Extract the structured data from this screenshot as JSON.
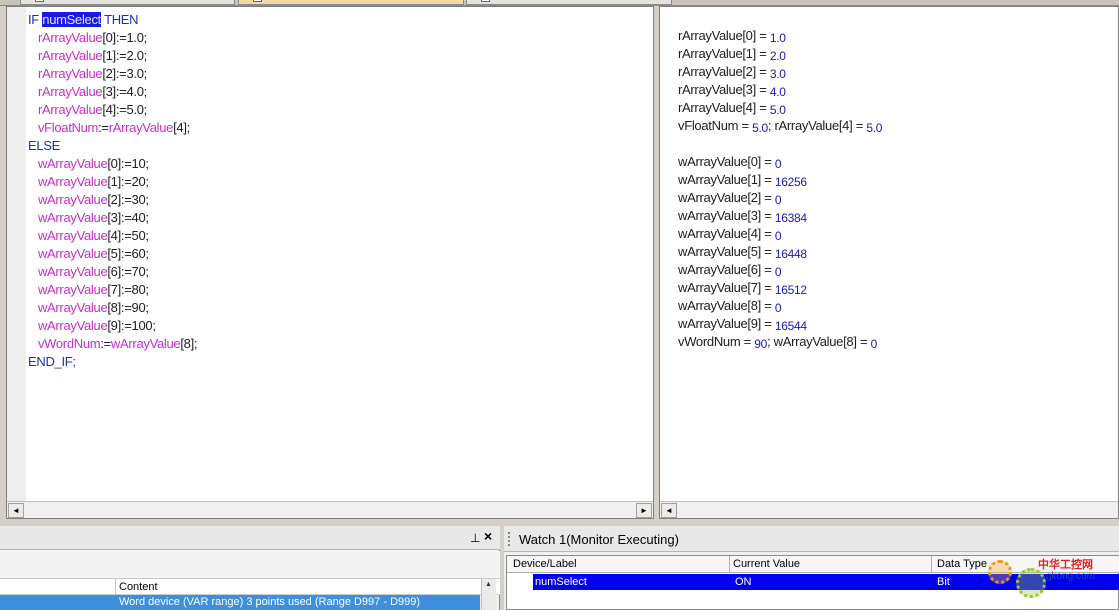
{
  "editor": {
    "lines": [
      [
        {
          "t": "IF ",
          "c": "kw"
        },
        {
          "t": "numSelect",
          "c": "hl"
        },
        {
          "t": " THEN",
          "c": "kw"
        }
      ],
      [
        {
          "t": "   ",
          "c": "plain"
        },
        {
          "t": "rArrayValue",
          "c": "var"
        },
        {
          "t": "[0]:=1.0;",
          "c": "plain"
        }
      ],
      [
        {
          "t": "   ",
          "c": "plain"
        },
        {
          "t": "rArrayValue",
          "c": "var"
        },
        {
          "t": "[1]:=2.0;",
          "c": "plain"
        }
      ],
      [
        {
          "t": "   ",
          "c": "plain"
        },
        {
          "t": "rArrayValue",
          "c": "var"
        },
        {
          "t": "[2]:=3.0;",
          "c": "plain"
        }
      ],
      [
        {
          "t": "   ",
          "c": "plain"
        },
        {
          "t": "rArrayValue",
          "c": "var"
        },
        {
          "t": "[3]:=4.0;",
          "c": "plain"
        }
      ],
      [
        {
          "t": "   ",
          "c": "plain"
        },
        {
          "t": "rArrayValue",
          "c": "var"
        },
        {
          "t": "[4]:=5.0;",
          "c": "plain"
        }
      ],
      [
        {
          "t": "   ",
          "c": "plain"
        },
        {
          "t": "vFloatNum",
          "c": "var"
        },
        {
          "t": ":=",
          "c": "plain"
        },
        {
          "t": "rArrayValue",
          "c": "var"
        },
        {
          "t": "[4];",
          "c": "plain"
        }
      ],
      [
        {
          "t": "ELSE",
          "c": "kw"
        }
      ],
      [
        {
          "t": "   ",
          "c": "plain"
        },
        {
          "t": "wArrayValue",
          "c": "var"
        },
        {
          "t": "[0]:=10;",
          "c": "plain"
        }
      ],
      [
        {
          "t": "   ",
          "c": "plain"
        },
        {
          "t": "wArrayValue",
          "c": "var"
        },
        {
          "t": "[1]:=20;",
          "c": "plain"
        }
      ],
      [
        {
          "t": "   ",
          "c": "plain"
        },
        {
          "t": "wArrayValue",
          "c": "var"
        },
        {
          "t": "[2]:=30;",
          "c": "plain"
        }
      ],
      [
        {
          "t": "   ",
          "c": "plain"
        },
        {
          "t": "wArrayValue",
          "c": "var"
        },
        {
          "t": "[3]:=40;",
          "c": "plain"
        }
      ],
      [
        {
          "t": "   ",
          "c": "plain"
        },
        {
          "t": "wArrayValue",
          "c": "var"
        },
        {
          "t": "[4]:=50;",
          "c": "plain"
        }
      ],
      [
        {
          "t": "   ",
          "c": "plain"
        },
        {
          "t": "wArrayValue",
          "c": "var"
        },
        {
          "t": "[5]:=60;",
          "c": "plain"
        }
      ],
      [
        {
          "t": "   ",
          "c": "plain"
        },
        {
          "t": "wArrayValue",
          "c": "var"
        },
        {
          "t": "[6]:=70;",
          "c": "plain"
        }
      ],
      [
        {
          "t": "   ",
          "c": "plain"
        },
        {
          "t": "wArrayValue",
          "c": "var"
        },
        {
          "t": "[7]:=80;",
          "c": "plain"
        }
      ],
      [
        {
          "t": "   ",
          "c": "plain"
        },
        {
          "t": "wArrayValue",
          "c": "var"
        },
        {
          "t": "[8]:=90;",
          "c": "plain"
        }
      ],
      [
        {
          "t": "   ",
          "c": "plain"
        },
        {
          "t": "wArrayValue",
          "c": "var"
        },
        {
          "t": "[9]:=100;",
          "c": "plain"
        }
      ],
      [
        {
          "t": "   ",
          "c": "plain"
        },
        {
          "t": "vWordNum",
          "c": "var"
        },
        {
          "t": ":=",
          "c": "plain"
        },
        {
          "t": "wArrayValue",
          "c": "var"
        },
        {
          "t": "[8];",
          "c": "plain"
        }
      ],
      [
        {
          "t": "END_IF;",
          "c": "kw"
        }
      ]
    ]
  },
  "monitor": {
    "lines": [
      [
        {
          "t": "rArrayValue[0] = "
        },
        {
          "t": "1.0",
          "v": true
        }
      ],
      [
        {
          "t": "rArrayValue[1] = "
        },
        {
          "t": "2.0",
          "v": true
        }
      ],
      [
        {
          "t": "rArrayValue[2] = "
        },
        {
          "t": "3.0",
          "v": true
        }
      ],
      [
        {
          "t": "rArrayValue[3] = "
        },
        {
          "t": "4.0",
          "v": true
        }
      ],
      [
        {
          "t": "rArrayValue[4] = "
        },
        {
          "t": "5.0",
          "v": true
        }
      ],
      [
        {
          "t": "vFloatNum = "
        },
        {
          "t": "5.0",
          "v": true
        },
        {
          "t": "; rArrayValue[4] = "
        },
        {
          "t": "5.0",
          "v": true
        }
      ],
      [],
      [
        {
          "t": "wArrayValue[0] = "
        },
        {
          "t": "0",
          "v": true
        }
      ],
      [
        {
          "t": "wArrayValue[1] = "
        },
        {
          "t": "16256",
          "v": true
        }
      ],
      [
        {
          "t": "wArrayValue[2] = "
        },
        {
          "t": "0",
          "v": true
        }
      ],
      [
        {
          "t": "wArrayValue[3] = "
        },
        {
          "t": "16384",
          "v": true
        }
      ],
      [
        {
          "t": "wArrayValue[4] = "
        },
        {
          "t": "0",
          "v": true
        }
      ],
      [
        {
          "t": "wArrayValue[5] = "
        },
        {
          "t": "16448",
          "v": true
        }
      ],
      [
        {
          "t": "wArrayValue[6] = "
        },
        {
          "t": "0",
          "v": true
        }
      ],
      [
        {
          "t": "wArrayValue[7] = "
        },
        {
          "t": "16512",
          "v": true
        }
      ],
      [
        {
          "t": "wArrayValue[8] = "
        },
        {
          "t": "0",
          "v": true
        }
      ],
      [
        {
          "t": "wArrayValue[9] = "
        },
        {
          "t": "16544",
          "v": true
        }
      ],
      [
        {
          "t": "vWordNum = "
        },
        {
          "t": "90",
          "v": true
        },
        {
          "t": "; wArrayValue[8] = "
        },
        {
          "t": "0",
          "v": true
        }
      ]
    ]
  },
  "scroll": {
    "left_arrow": "◄",
    "right_arrow": "►",
    "up_arrow": "▲"
  },
  "device_panel": {
    "pin_glyph": "⊥",
    "close_glyph": "×",
    "column_header": "Content",
    "row_content": "Word device (VAR range) 3 points used (Range D997 - D999)"
  },
  "watch": {
    "title": "Watch 1(Monitor Executing)",
    "columns": [
      "Device/Label",
      "Current Value",
      "Data Type"
    ],
    "row": {
      "device": "numSelect",
      "value": "ON",
      "type": "Bit"
    }
  },
  "watermark": {
    "cn": "中华工控网",
    "url": "gkong.com"
  },
  "colors": {
    "keyword": "#1f2fa8",
    "variable": "#c72ec7",
    "value": "#1a1aa8",
    "selection": "#0000ee",
    "highlight": "#1a1ae6"
  }
}
